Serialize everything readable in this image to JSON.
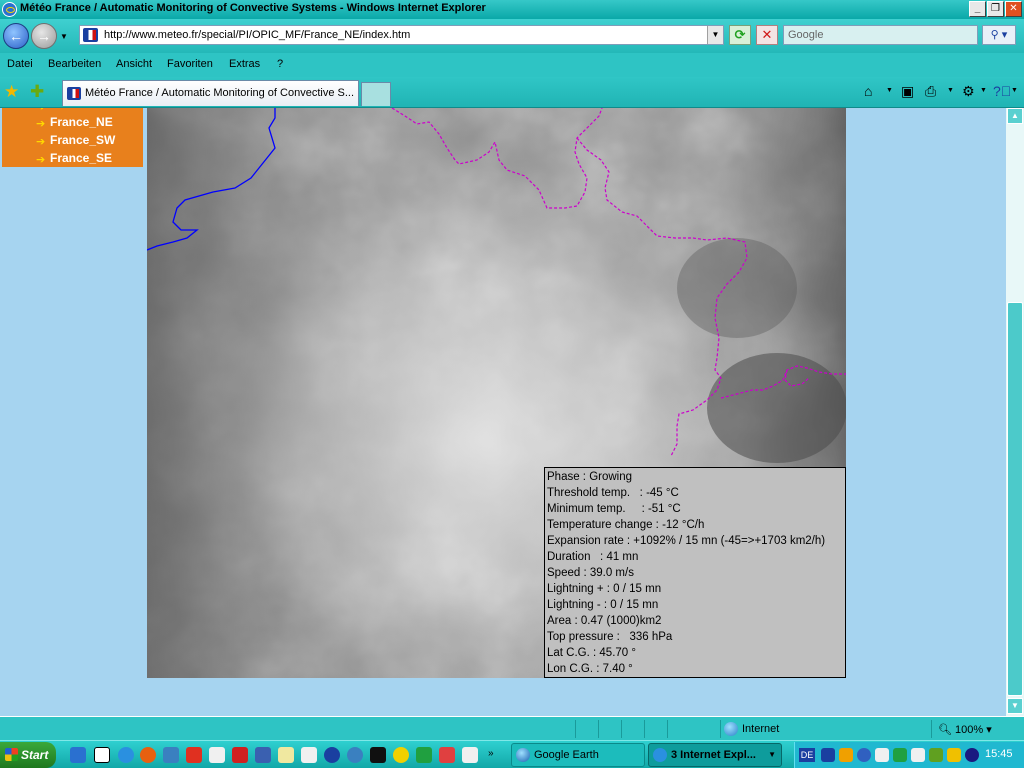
{
  "window": {
    "title": "Météo France / Automatic Monitoring of Convective Systems - Windows Internet Explorer"
  },
  "titlebar_buttons": {
    "minimize": "_",
    "maximize": "❐",
    "close": "✕"
  },
  "navigation": {
    "back": "←",
    "forward": "→",
    "url": "http://www.meteo.fr/special/PI/OPIC_MF/France_NE/index.htm",
    "search_placeholder": "Google"
  },
  "menu": [
    "Datei",
    "Bearbeiten",
    "Ansicht",
    "Favoriten",
    "Extras",
    "?"
  ],
  "tab": {
    "label": "Météo France / Automatic Monitoring of Convective S..."
  },
  "sidebar": {
    "items": [
      {
        "label": "France_NE"
      },
      {
        "label": "France_SW"
      },
      {
        "label": "France_SE"
      }
    ]
  },
  "info_box": {
    "rows": [
      "Phase : Growing",
      "Threshold temp.   : -45 °C",
      "Minimum temp.     : -51 °C",
      "Temperature change : -12 °C/h",
      "Expansion rate : +1092% / 15 mn (-45=>+1703 km2/h)",
      "Duration   : 41 mn",
      "Speed : 39.0 m/s",
      "Lightning + : 0 / 15 mn",
      "Lightning - : 0 / 15 mn",
      "Area : 0.47 (1000)km2",
      "Top pressure :   336 hPa",
      "Lat C.G. : 45.70 °",
      "Lon C.G. : 7.40 °"
    ]
  },
  "status": {
    "zone": "Internet",
    "zoom": "100%"
  },
  "taskbar": {
    "start": "Start",
    "tasks": [
      {
        "label": "Google Earth"
      },
      {
        "label": "3 Internet Expl..."
      }
    ],
    "tray_lang": "DE",
    "clock": "15:45"
  },
  "colors": {
    "chrome": "#2ec4c4",
    "sidebar_menu": "#e8801c",
    "page_background": "#a6d4f0",
    "coastline": "#0000ff",
    "border_line": "#cc00cc",
    "info_box": "#c0c0c0"
  }
}
